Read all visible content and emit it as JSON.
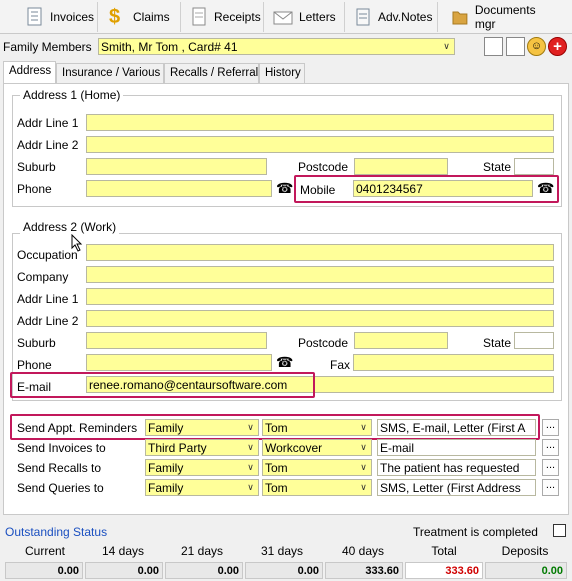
{
  "toolbar": {
    "invoices": "Invoices",
    "claims": "Claims",
    "receipts": "Receipts",
    "letters": "Letters",
    "adv_notes": "Adv.Notes",
    "documents": "Documents mgr"
  },
  "family": {
    "label": "Family Members",
    "value": "Smith, Mr Tom , Card# 41"
  },
  "tabs": [
    "Address",
    "Insurance / Various",
    "Recalls / Referral",
    "History"
  ],
  "address1": {
    "title": "Address 1 (Home)",
    "addr_line1_label": "Addr Line 1",
    "addr_line2_label": "Addr Line 2",
    "suburb_label": "Suburb",
    "postcode_label": "Postcode",
    "state_label": "State",
    "phone_label": "Phone",
    "mobile_label": "Mobile",
    "mobile_value": "0401234567"
  },
  "address2": {
    "title": "Address 2 (Work)",
    "occupation_label": "Occupation",
    "company_label": "Company",
    "addr_line1_label": "Addr Line 1",
    "addr_line2_label": "Addr Line 2",
    "suburb_label": "Suburb",
    "postcode_label": "Postcode",
    "state_label": "State",
    "phone_label": "Phone",
    "fax_label": "Fax",
    "email_label": "E-mail",
    "email_value": "renee.romano@centaursoftware.com"
  },
  "send": [
    {
      "label": "Send Appt. Reminders",
      "who": "Family",
      "person": "Tom",
      "method": "SMS, E-mail, Letter (First A"
    },
    {
      "label": "Send Invoices to",
      "who": "Third Party",
      "person": "Workcover",
      "method": "E-mail"
    },
    {
      "label": "Send Recalls to",
      "who": "Family",
      "person": "Tom",
      "method": "The patient has requested"
    },
    {
      "label": "Send Queries to",
      "who": "Family",
      "person": "Tom",
      "method": "SMS, Letter (First Address"
    }
  ],
  "status": {
    "title": "Outstanding Status",
    "treatment_label": "Treatment is completed",
    "headers": [
      "Current",
      "14 days",
      "21 days",
      "31 days",
      "40 days",
      "Total",
      "Deposits"
    ],
    "values": [
      "0.00",
      "0.00",
      "0.00",
      "0.00",
      "333.60",
      "333.60",
      "0.00"
    ],
    "colors": {
      "total": "#d00000",
      "deposits": "#007a00"
    }
  }
}
